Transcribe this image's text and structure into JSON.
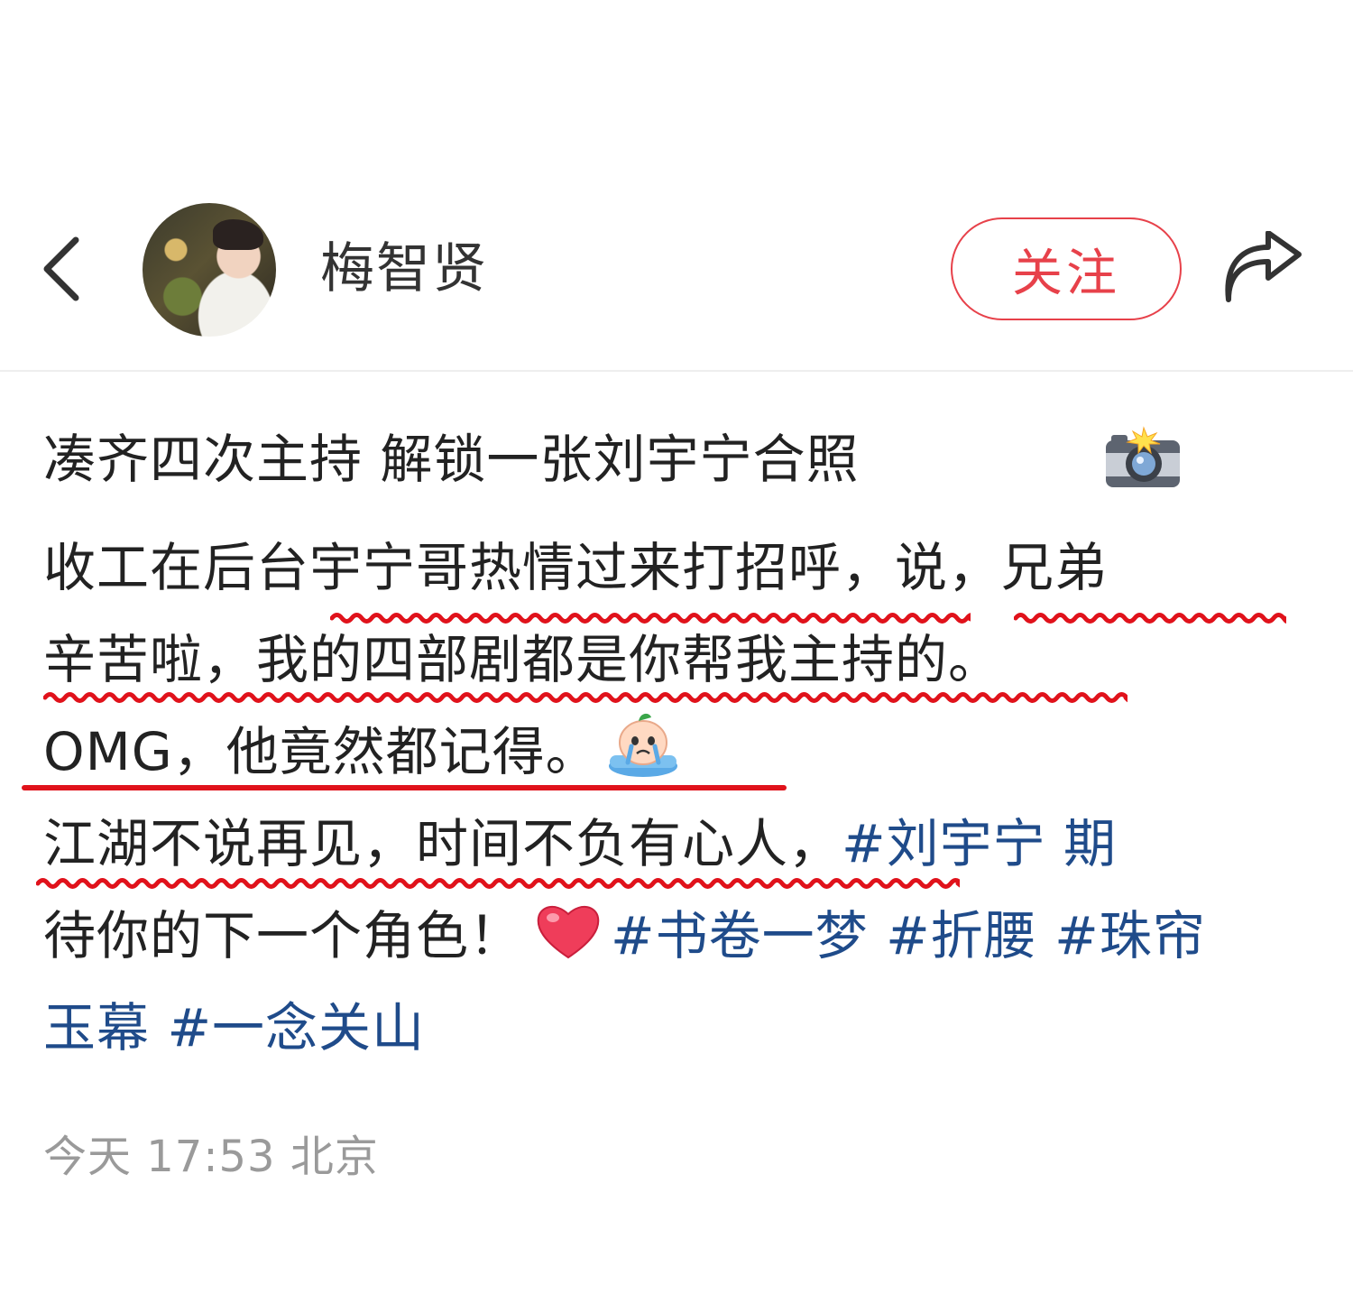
{
  "header": {
    "username": "梅智贤",
    "follow_label": "关注",
    "icons": {
      "back": "back-arrow-icon",
      "share": "share-icon",
      "avatar": "avatar"
    }
  },
  "post": {
    "title": "凑齐四次主持 解锁一张刘宇宁合照",
    "line1": "收工在后台宇宁哥热情过来打招呼，说，兄弟",
    "line2": "辛苦啦，我的四部剧都是你帮我主持的。",
    "line3": "OMG，他竟然都记得。",
    "line4_text": "江湖不说再见，时间不负有心人，",
    "line4_tag": "#刘宇宁 期",
    "line5_text": "待你的下一个角色！",
    "line5_tags": [
      "#书卷一梦",
      "#折腰",
      "#珠帘"
    ],
    "line6_text": "玉幕",
    "line6_tag": "#一念关山",
    "timestamp": "今天 17:53 北京"
  },
  "colors": {
    "accent_red": "#e7414a",
    "hashtag_blue": "#1f4b8a",
    "underline_red": "#e0121b",
    "timestamp_gray": "#9a9a9a"
  }
}
